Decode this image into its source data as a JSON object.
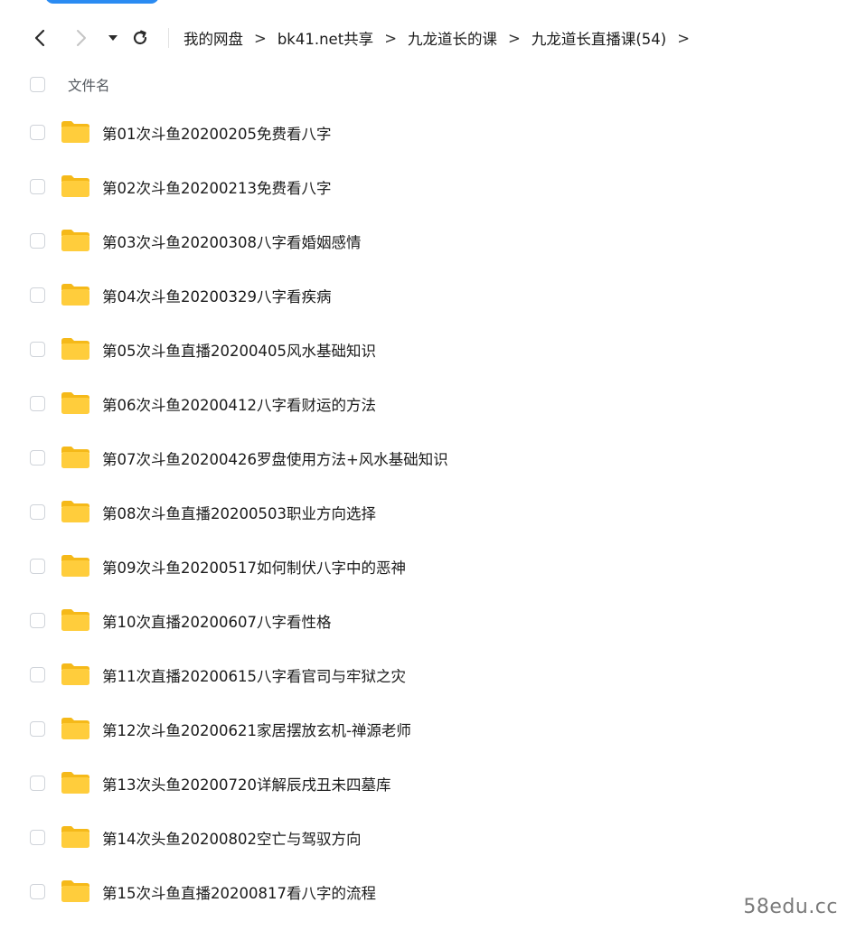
{
  "nav": {
    "back_icon": "chevron-left-icon",
    "forward_icon": "chevron-right-icon",
    "menu_icon": "caret-down-icon",
    "refresh_icon": "refresh-icon"
  },
  "breadcrumb": {
    "items": [
      "我的网盘",
      "bk41.net共享",
      "九龙道长的课",
      "九龙道长直播课(54)"
    ],
    "separator": ">"
  },
  "list_header": {
    "filename_label": "文件名"
  },
  "files": [
    {
      "name": "第01次斗鱼20200205免费看八字",
      "icon": "folder-icon"
    },
    {
      "name": "第02次斗鱼20200213免费看八字",
      "icon": "folder-icon"
    },
    {
      "name": "第03次斗鱼20200308八字看婚姻感情",
      "icon": "folder-icon"
    },
    {
      "name": "第04次斗鱼20200329八字看疾病",
      "icon": "folder-icon"
    },
    {
      "name": "第05次斗鱼直播20200405风水基础知识",
      "icon": "folder-icon"
    },
    {
      "name": "第06次斗鱼20200412八字看财运的方法",
      "icon": "folder-icon"
    },
    {
      "name": "第07次斗鱼20200426罗盘使用方法+风水基础知识",
      "icon": "folder-icon"
    },
    {
      "name": "第08次斗鱼直播20200503职业方向选择",
      "icon": "folder-icon"
    },
    {
      "name": "第09次斗鱼20200517如何制伏八字中的恶神",
      "icon": "folder-icon"
    },
    {
      "name": "第10次直播20200607八字看性格",
      "icon": "folder-icon"
    },
    {
      "name": "第11次直播20200615八字看官司与牢狱之灾",
      "icon": "folder-icon"
    },
    {
      "name": "第12次斗鱼20200621家居摆放玄机-禅源老师",
      "icon": "folder-icon"
    },
    {
      "name": "第13次头鱼20200720详解辰戌丑未四墓库",
      "icon": "folder-icon"
    },
    {
      "name": "第14次头鱼20200802空亡与驾驭方向",
      "icon": "folder-icon"
    },
    {
      "name": "第15次斗鱼直播20200817看八字的流程",
      "icon": "folder-icon"
    }
  ],
  "watermark": "58edu.cc",
  "colors": {
    "folder": "#ffcd3c",
    "folder_back": "#f5b919",
    "accent": "#2a8bf2",
    "checkbox_border": "#cfd3d9"
  }
}
